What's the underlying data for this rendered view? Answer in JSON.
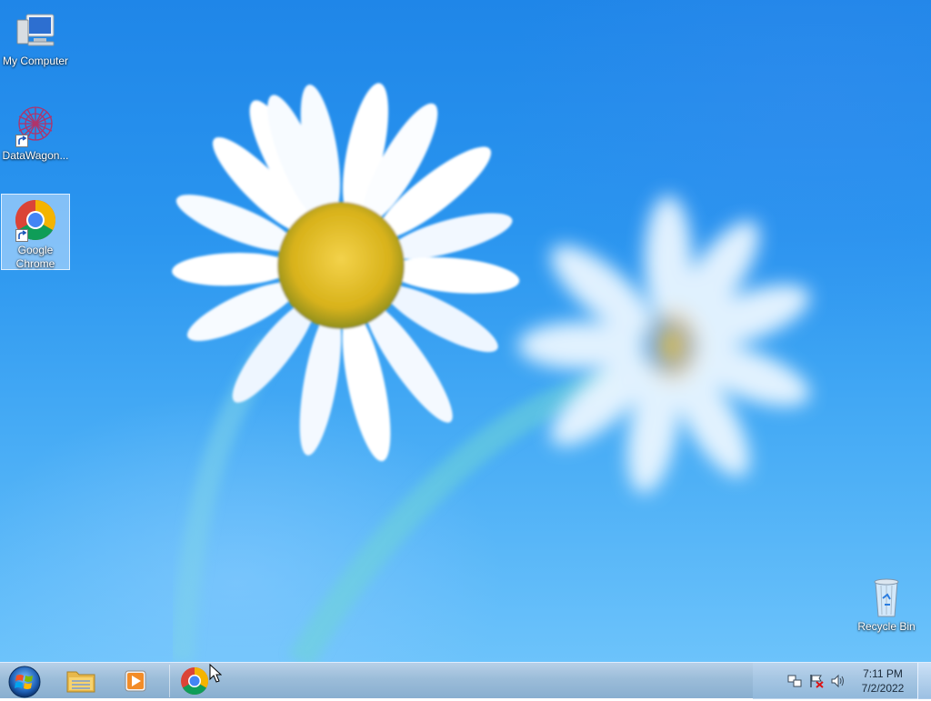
{
  "desktop": {
    "icons": [
      {
        "name": "my-computer",
        "label": "My Computer",
        "icon": "computer-icon"
      },
      {
        "name": "datawagon",
        "label": "DataWagon...",
        "icon": "datawagon-icon",
        "shortcut": true
      },
      {
        "name": "google-chrome",
        "label": "Google Chrome",
        "icon": "chrome-icon",
        "shortcut": true,
        "selected": true
      },
      {
        "name": "recycle-bin",
        "label": "Recycle Bin",
        "icon": "recycle-bin-icon"
      }
    ]
  },
  "taskbar": {
    "start_icon": "windows-logo-icon",
    "pinned": [
      {
        "name": "file-explorer",
        "icon": "folder-icon"
      },
      {
        "name": "media-player",
        "icon": "media-player-icon"
      },
      {
        "name": "chrome",
        "icon": "chrome-icon"
      }
    ],
    "tray": {
      "icons": [
        "network-icon",
        "action-center-flag-icon",
        "volume-icon"
      ],
      "time": "7:11 PM",
      "date": "7/2/2022"
    }
  },
  "colors": {
    "wallpaper_top": "#1f86e8",
    "wallpaper_bottom": "#6cc3fb",
    "taskbar": "#9fc0de"
  }
}
